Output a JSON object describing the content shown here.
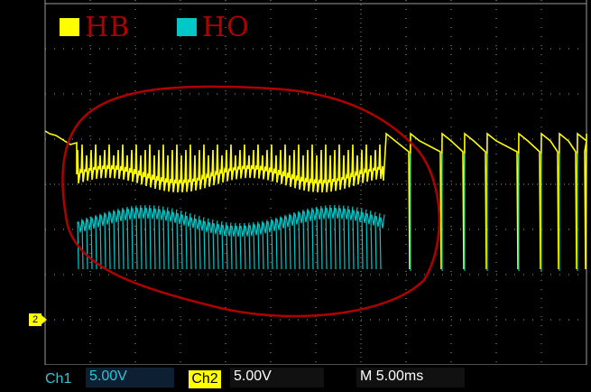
{
  "legend": [
    {
      "name": "HB",
      "color": "#ffff00"
    },
    {
      "name": "HO",
      "color": "#00c8c8"
    }
  ],
  "status": {
    "ch1_label": "Ch1",
    "ch1_scale": "5.00V",
    "ch2_label": "Ch2",
    "ch2_scale": "5.00V",
    "time_scale": "M 5.00ms"
  },
  "marker": {
    "label": "2"
  },
  "colors": {
    "grid": "#9a9a9a",
    "annotation": "#b00000",
    "hb": "#ffff00",
    "ho": "#00c8c8"
  }
}
